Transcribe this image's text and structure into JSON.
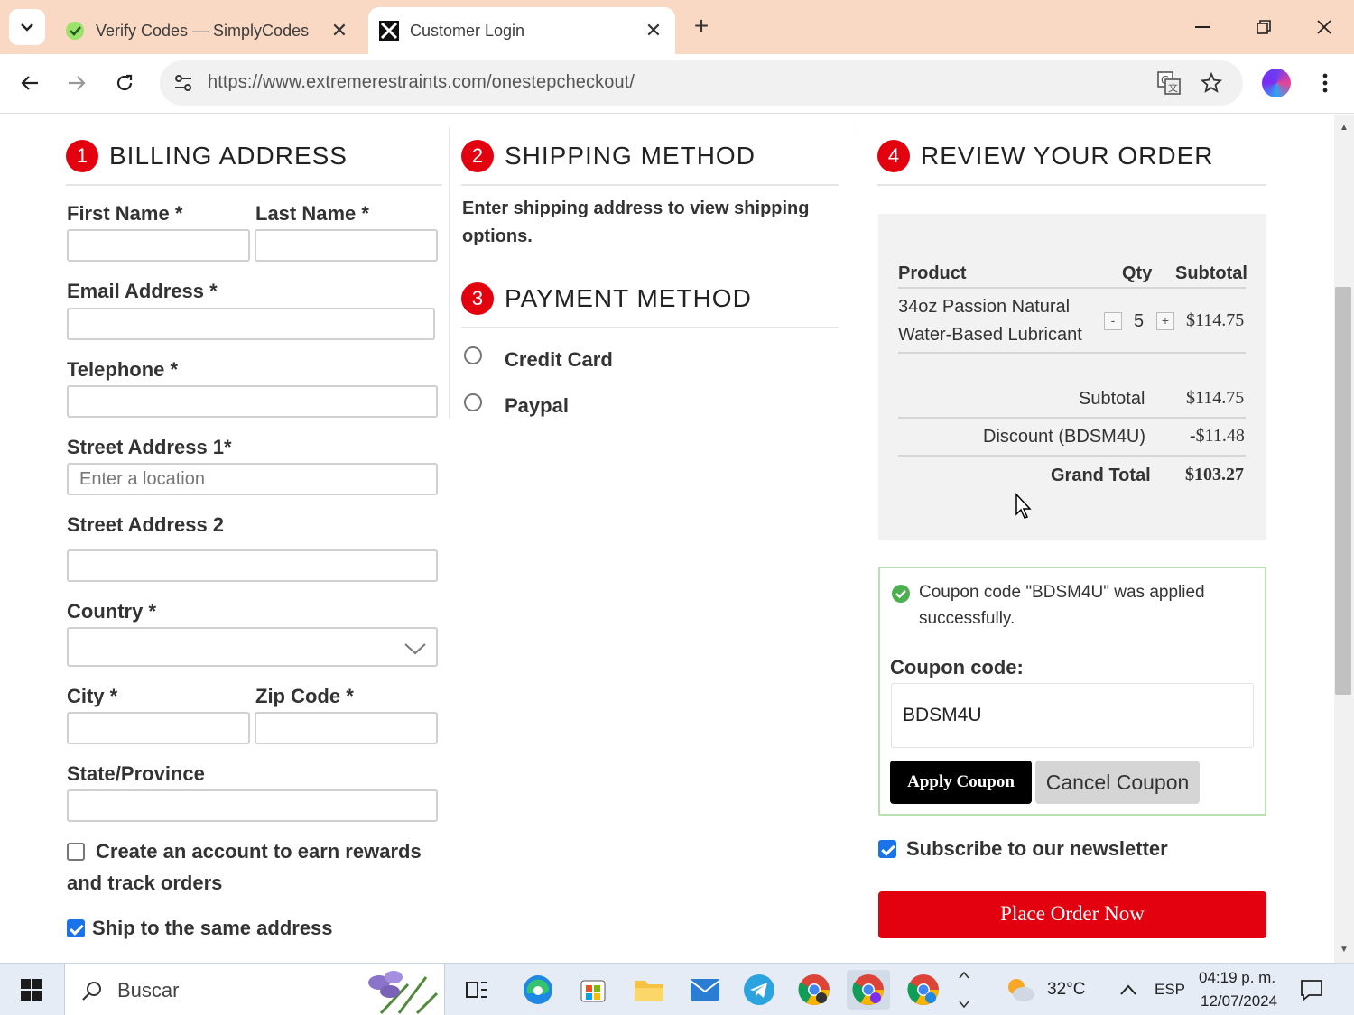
{
  "browser": {
    "tabs": [
      {
        "title": "Verify Codes — SimplyCodes",
        "icon": "simplycodes-icon",
        "active": false
      },
      {
        "title": "Customer Login",
        "icon": "site-icon",
        "active": true
      }
    ],
    "url": "https://www.extremerestraints.com/onestepcheckout/"
  },
  "billing": {
    "number": "1",
    "title": "BILLING ADDRESS",
    "first_name_label": "First Name *",
    "last_name_label": "Last Name *",
    "email_label": "Email Address *",
    "telephone_label": "Telephone *",
    "street1_label": "Street Address 1*",
    "street1_placeholder": "Enter a location",
    "street2_label": "Street Address 2",
    "country_label": "Country *",
    "city_label": "City *",
    "zip_label": "Zip Code *",
    "state_label": "State/Province",
    "create_account_line1": "Create an account to earn rewards",
    "create_account_line2": "and track orders",
    "create_account_checked": false,
    "ship_same_label": "Ship to the same address",
    "ship_same_checked": true
  },
  "shipping": {
    "number": "2",
    "title": "SHIPPING METHOD",
    "message_line1": "Enter shipping address to view shipping",
    "message_line2": "options."
  },
  "payment": {
    "number": "3",
    "title": "PAYMENT METHOD",
    "options": [
      "Credit Card",
      "Paypal"
    ]
  },
  "review": {
    "number": "4",
    "title": "REVIEW YOUR ORDER",
    "headers": {
      "product": "Product",
      "qty": "Qty",
      "subtotal": "Subtotal"
    },
    "items": [
      {
        "name_line1": "34oz Passion Natural",
        "name_line2": "Water-Based Lubricant",
        "qty": "5",
        "minus": "-",
        "plus": "+",
        "subtotal": "$114.75"
      }
    ],
    "totals": {
      "subtotal_label": "Subtotal",
      "subtotal_value": "$114.75",
      "discount_label": "Discount (BDSM4U)",
      "discount_value": "-$11.48",
      "grand_label": "Grand Total",
      "grand_value": "$103.27"
    }
  },
  "coupon": {
    "message_line1": "Coupon code \"BDSM4U\" was applied",
    "message_line2": "successfully.",
    "label": "Coupon code:",
    "value": "BDSM4U",
    "apply_label": "Apply Coupon",
    "cancel_label": "Cancel Coupon"
  },
  "newsletter": {
    "label": "Subscribe to our newsletter",
    "checked": true
  },
  "place_order_label": "Place Order Now",
  "taskbar": {
    "search_placeholder": "Buscar",
    "weather": "32°C",
    "language": "ESP",
    "time": "04:19 p. m.",
    "date": "12/07/2024"
  },
  "colors": {
    "accent": "#e3000f",
    "checkbox": "#1a73e8",
    "tab_strip": "#f9d8c4"
  }
}
